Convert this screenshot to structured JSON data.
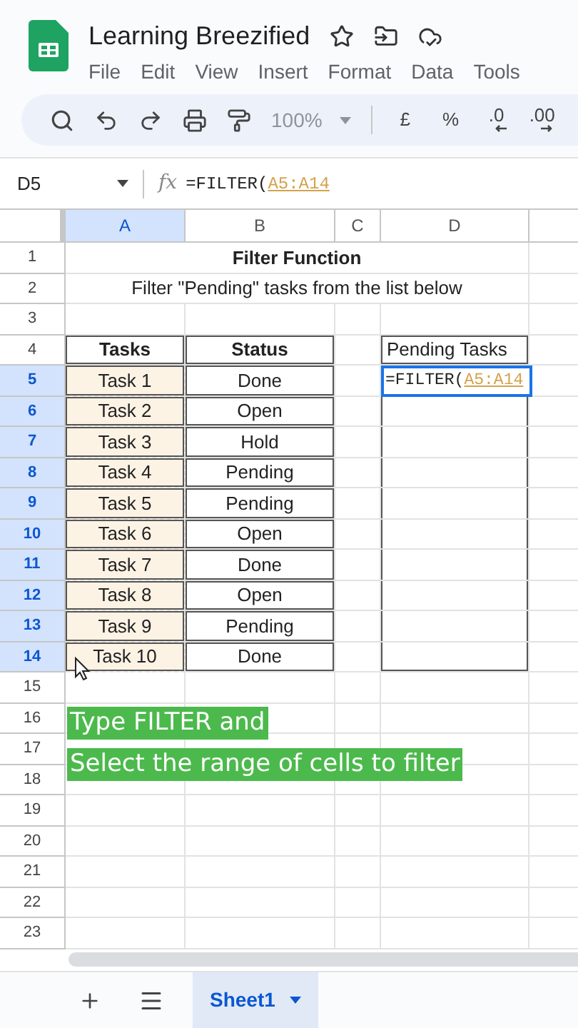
{
  "document": {
    "title": "Learning Breezified"
  },
  "menu": [
    "File",
    "Edit",
    "View",
    "Insert",
    "Format",
    "Data",
    "Tools"
  ],
  "toolbar": {
    "zoom": {
      "label": "100%",
      "disabled": true
    },
    "format_buttons": [
      {
        "kind": "text",
        "label": "£"
      },
      {
        "kind": "text",
        "label": "%"
      },
      {
        "kind": "decimal-decrease",
        "label": ".0"
      },
      {
        "kind": "decimal-increase",
        "label": ".00"
      }
    ]
  },
  "name_box": "D5",
  "formula": {
    "label": "fx",
    "prefix": "=FILTER(",
    "range": "A5:A14"
  },
  "columns": [
    {
      "label": "A",
      "selected": true
    },
    {
      "label": "B",
      "selected": false
    },
    {
      "label": "C",
      "selected": false
    },
    {
      "label": "D",
      "selected": false
    }
  ],
  "row_headers": [
    {
      "label": "1",
      "selected": false
    },
    {
      "label": "2",
      "selected": false
    },
    {
      "label": "3",
      "selected": false
    },
    {
      "label": "4",
      "selected": false
    },
    {
      "label": "5",
      "selected": true
    },
    {
      "label": "6",
      "selected": true
    },
    {
      "label": "7",
      "selected": true
    },
    {
      "label": "8",
      "selected": true
    },
    {
      "label": "9",
      "selected": true
    },
    {
      "label": "10",
      "selected": true
    },
    {
      "label": "11",
      "selected": true
    },
    {
      "label": "12",
      "selected": true
    },
    {
      "label": "13",
      "selected": true
    },
    {
      "label": "14",
      "selected": true
    },
    {
      "label": "15",
      "selected": false
    },
    {
      "label": "16",
      "selected": false
    },
    {
      "label": "17",
      "selected": false
    },
    {
      "label": "18",
      "selected": false
    },
    {
      "label": "19",
      "selected": false
    },
    {
      "label": "20",
      "selected": false
    },
    {
      "label": "21",
      "selected": false
    },
    {
      "label": "22",
      "selected": false
    },
    {
      "label": "23",
      "selected": false
    }
  ],
  "sheet_title": "Filter Function",
  "sheet_subtitle": "Filter \"Pending\" tasks from the list below",
  "table": {
    "columns": [
      "Tasks",
      "Status"
    ],
    "rows": [
      [
        "Task 1",
        "Done"
      ],
      [
        "Task 2",
        "Open"
      ],
      [
        "Task 3",
        "Hold"
      ],
      [
        "Task 4",
        "Pending"
      ],
      [
        "Task 5",
        "Pending"
      ],
      [
        "Task 6",
        "Open"
      ],
      [
        "Task 7",
        "Done"
      ],
      [
        "Task 8",
        "Open"
      ],
      [
        "Task 9",
        "Pending"
      ],
      [
        "Task 10",
        "Done"
      ]
    ]
  },
  "result": {
    "header": "Pending Tasks",
    "editing": {
      "prefix": "=FILTER(",
      "range": "A5:A14"
    }
  },
  "captions": [
    "Type FILTER and",
    "Select the range of cells to filter"
  ],
  "sheet_tabs": [
    {
      "label": "Sheet1",
      "selected": true
    }
  ]
}
